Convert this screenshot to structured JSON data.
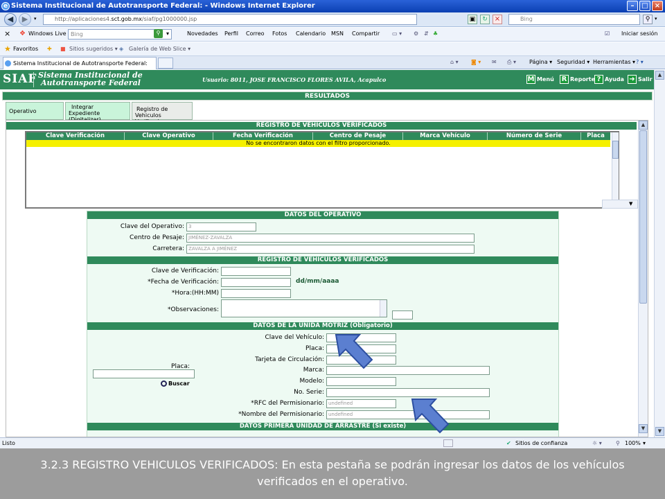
{
  "window": {
    "title": "Sistema Institucional de Autotransporte Federal: - Windows Internet Explorer",
    "minimize": "–",
    "maximize": "□",
    "close": "×"
  },
  "address": {
    "url_prefix": "http://aplicaciones4.",
    "url_domain": "sct.gob.mx",
    "url_path": "/siaf/pg1000000.jsp",
    "search_placeholder": "Bing"
  },
  "wl_toolbar": {
    "close": "×",
    "brand": "Windows Live",
    "search_placeholder": "Bing",
    "links": [
      "Novedades",
      "Perfil",
      "Correo",
      "Fotos",
      "Calendario",
      "MSN",
      "Compartir"
    ],
    "signin": "Iniciar sesión"
  },
  "favorites_bar": {
    "favorites": "Favoritos",
    "suggested": "Sitios sugeridos ▾",
    "webslice": "Galería de Web Slice ▾"
  },
  "tab": {
    "title": "Sistema Institucional de Autotransporte Federal:",
    "tools": [
      "Página ▾",
      "Seguridad ▾",
      "Herramientas ▾"
    ]
  },
  "app": {
    "logo": "SIAF",
    "name_line1": "Sistema Institucional de",
    "name_line2": "Autotransporte Federal",
    "user": "Usuario: 8011, JOSE FRANCISCO FLORES AVILA, Acapulco",
    "menu_label": "Menú",
    "reporte_label": "Reporte",
    "ayuda_label": "Ayuda",
    "salir_label": "Salir",
    "menu_icon": "M",
    "reporte_icon": "R",
    "ayuda_icon": "?",
    "salir_icon": "➜",
    "results_title": "RESULTADOS",
    "tabs": {
      "operativo": "Operativo",
      "integrar_l1": "Integrar",
      "integrar_l2": "Expediente",
      "integrar_l3": "(Digitalizar)",
      "registro_l1": "Registro de",
      "registro_l2": "Vehiculos Verificados"
    }
  },
  "registro_grid": {
    "title": "REGISTRO DE VEHÍCULOS VERIFICADOS",
    "columns": [
      "Clave Verificación",
      "Clave Operativo",
      "Fecha Verificación",
      "Centro de Pesaje",
      "Marca Vehículo",
      "Número de Serie",
      "Placa"
    ],
    "empty_message": "No se encontraron datos con el filtro proporcionado."
  },
  "datos_operativo": {
    "title": "DATOS DEL OPERATIVO",
    "clave_label": "Clave del Operativo:",
    "clave_value": "3",
    "centro_label": "Centro de Pesaje:",
    "centro_value": "JIMÉNEZ-ZAVALZA",
    "carretera_label": "Carretera:",
    "carretera_value": "ZAVALZA A JIMÉNEZ"
  },
  "registro_form": {
    "title": "REGISTRO DE VEHÍCULOS VERIFICADOS",
    "clave_label": "Clave de Verificación:",
    "fecha_label": "*Fecha de Verificación:",
    "fecha_format": "dd/mm/aaaa",
    "hora_label": "*Hora:(HH:MM)",
    "obs_label": "*Observaciones:"
  },
  "unidad_motriz": {
    "title": "DATOS DE LA UNIDA MOTRIZ (Obligatorio)",
    "placa_search_label": "Placa:",
    "buscar": "Buscar",
    "fields": [
      {
        "label": "Clave del Vehículo:",
        "value": ""
      },
      {
        "label": "Placa:",
        "value": ""
      },
      {
        "label": "Tarjeta de Circulación:",
        "value": ""
      },
      {
        "label": "Marca:",
        "value": ""
      },
      {
        "label": "Modelo:",
        "value": ""
      },
      {
        "label": "No. Serie:",
        "value": ""
      },
      {
        "label": "*RFC del Permisionario:",
        "value": "undefined"
      },
      {
        "label": "*Nombre del Permisionario:",
        "value": "undefined"
      }
    ]
  },
  "arrastre": {
    "title": "DATOS PRIMERA UNIDAD DE ARRASTRE (Si existe)"
  },
  "status": {
    "text": "Listo",
    "zone": "Sitios de confianza",
    "zoom": "100%"
  },
  "caption": "3.2.3 REGISTRO VEHICULOS VERIFICADOS: En esta pestaña se podrán ingresar los datos de los vehículos verificados en el operativo.",
  "colors": {
    "siaf_green": "#2f8a5b",
    "tab_green": "#c9f4da",
    "yellow_row": "#f5f000",
    "arrow_blue": "#5b7fd0"
  }
}
